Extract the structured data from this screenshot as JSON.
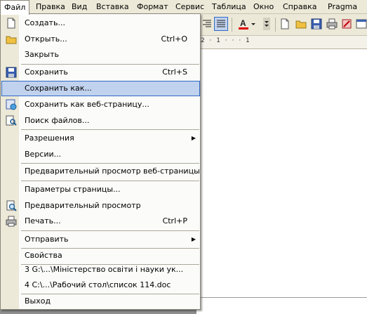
{
  "menubar": {
    "items": [
      "Файл",
      "Правка",
      "Вид",
      "Вставка",
      "Формат",
      "Сервис",
      "Таблица",
      "Окно",
      "Справка",
      "Pragma"
    ]
  },
  "toolbar": {
    "icons": [
      "align-right-icon",
      "justify-icon",
      "font-color-icon",
      "dropdown-arrow-icon",
      "new-document-icon",
      "open-folder-icon",
      "save-icon",
      "print-icon",
      "erase-icon",
      "window-icon"
    ],
    "font_color_letter": "A",
    "font_color": "#e00000"
  },
  "ruler": {
    "text": "2 · 1 · · · 1"
  },
  "file_menu": {
    "items": [
      {
        "label": "Создать...",
        "shortcut": "",
        "icon": "new-document-icon"
      },
      {
        "label": "Открыть...",
        "shortcut": "Ctrl+O",
        "icon": "open-folder-icon"
      },
      {
        "label": "Закрыть",
        "shortcut": "",
        "icon": ""
      },
      {
        "label": "Сохранить",
        "shortcut": "Ctrl+S",
        "icon": "save-icon"
      },
      {
        "label": "Сохранить как...",
        "shortcut": "",
        "icon": ""
      },
      {
        "label": "Сохранить как веб-страницу...",
        "shortcut": "",
        "icon": "save-web-icon"
      },
      {
        "label": "Поиск файлов...",
        "shortcut": "",
        "icon": "search-files-icon"
      },
      {
        "label": "Разрешения",
        "shortcut": "",
        "icon": ""
      },
      {
        "label": "Версии...",
        "shortcut": "",
        "icon": ""
      },
      {
        "label": "Предварительный просмотр веб-страницы",
        "shortcut": "",
        "icon": ""
      },
      {
        "label": "Параметры страницы...",
        "shortcut": "",
        "icon": ""
      },
      {
        "label": "Предварительный просмотр",
        "shortcut": "",
        "icon": "print-preview-icon"
      },
      {
        "label": "Печать...",
        "shortcut": "Ctrl+P",
        "icon": "print-icon"
      },
      {
        "label": "Отправить",
        "shortcut": "",
        "icon": ""
      },
      {
        "label": "Свойства",
        "shortcut": "",
        "icon": ""
      },
      {
        "label": "3 G:\\...\\Міністерство освіти і науки ук...",
        "shortcut": "",
        "icon": ""
      },
      {
        "label": "4 C:\\...\\Рабочий стол\\список 114.doc",
        "shortcut": "",
        "icon": ""
      },
      {
        "label": "Выход",
        "shortcut": "",
        "icon": ""
      }
    ]
  }
}
